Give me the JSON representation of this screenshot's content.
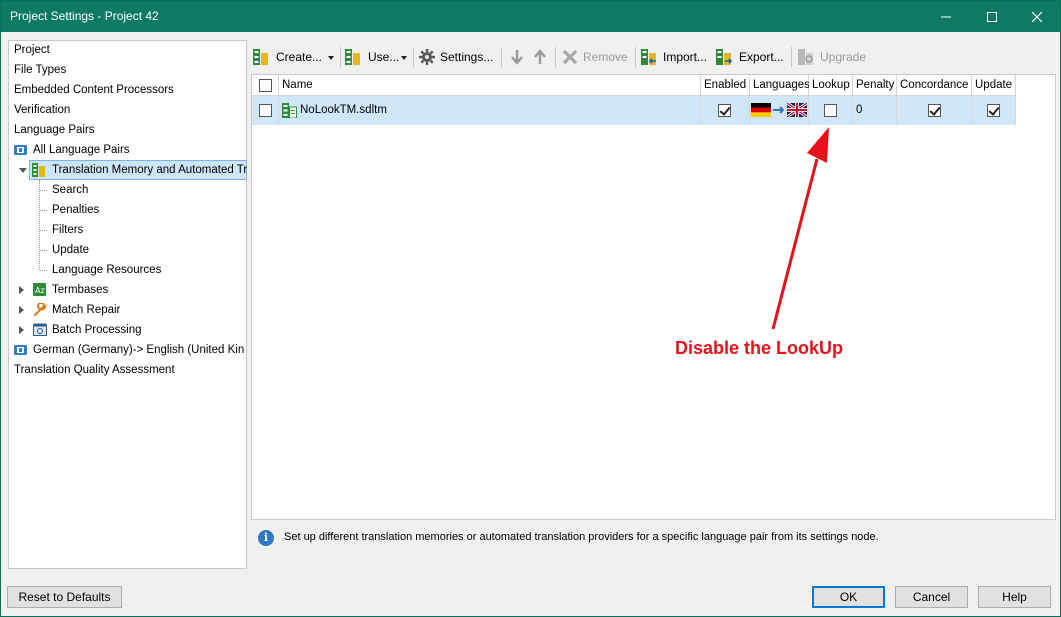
{
  "window": {
    "title": "Project Settings - Project 42"
  },
  "tree": {
    "items": [
      {
        "label": "Project"
      },
      {
        "label": "File Types"
      },
      {
        "label": "Embedded Content Processors"
      },
      {
        "label": "Verification"
      },
      {
        "label": "Language Pairs"
      },
      {
        "label": "All Language Pairs"
      },
      {
        "label": "Translation Memory and Automated Translation"
      },
      {
        "label": "Search"
      },
      {
        "label": "Penalties"
      },
      {
        "label": "Filters"
      },
      {
        "label": "Update"
      },
      {
        "label": "Language Resources"
      },
      {
        "label": "Termbases"
      },
      {
        "label": "Match Repair"
      },
      {
        "label": "Batch Processing"
      },
      {
        "label": "German (Germany)-> English (United Kingdom)"
      },
      {
        "label": "Translation Quality Assessment"
      }
    ]
  },
  "toolbar": {
    "create": "Create...",
    "use": "Use...",
    "settings": "Settings...",
    "remove": "Remove",
    "import": "Import...",
    "export": "Export...",
    "upgrade": "Upgrade"
  },
  "grid": {
    "columns": [
      "Name",
      "Enabled",
      "Languages",
      "Lookup",
      "Penalty",
      "Concordance",
      "Update"
    ],
    "rows": [
      {
        "name": "NoLookTM.sdltm",
        "enabled": true,
        "lookup": false,
        "penalty": "0",
        "concordance": true,
        "update": true
      }
    ]
  },
  "info": {
    "text": "Set up different translation memories or automated translation providers for a specific language pair from its settings node."
  },
  "buttons": {
    "reset": "Reset to Defaults",
    "ok": "OK",
    "cancel": "Cancel",
    "help": "Help"
  },
  "annotation": {
    "text": "Disable the LookUp",
    "color": "#e8111b"
  },
  "colors": {
    "titlebar": "#0d7a64",
    "selection": "#cfe7f8"
  }
}
